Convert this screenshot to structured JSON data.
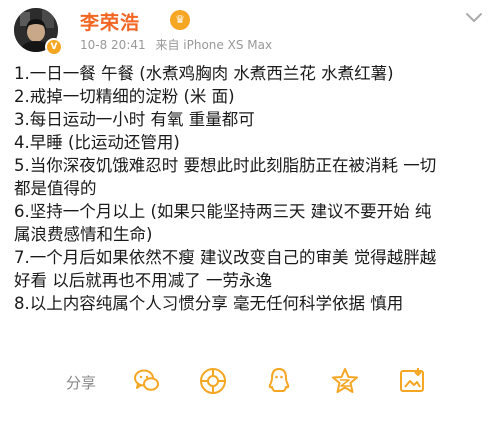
{
  "post": {
    "username": "李荣浩",
    "meta": {
      "time": "10-8 20:41",
      "source": "来自 iPhone XS Max"
    },
    "lines": [
      "1.一日一餐 午餐 (水煮鸡胸肉 水煮西兰花 水煮红薯)",
      "2.戒掉一切精细的淀粉 (米 面)",
      "3.每日运动一小时 有氧 重量都可",
      "4.早睡 (比运动还管用)",
      "5.当你深夜饥饿难忍时 要想此时此刻脂肪正在被消耗 一切",
      "都是值得的",
      "6.坚持一个月以上 (如果只能坚持两三天 建议不要开始 纯",
      "属浪费感情和生命)",
      "7.一个月后如果依然不瘦 建议改变自己的审美 觉得越胖越",
      "好看 以后就再也不用减了 一劳永逸",
      "8.以上内容纯属个人习惯分享 毫无任何科学依据 慎用"
    ]
  },
  "share": {
    "label": "分享",
    "icons": [
      "wechat-icon",
      "moments-icon",
      "qq-icon",
      "qzone-icon",
      "save-image-icon"
    ]
  },
  "colors": {
    "username": "#f26522",
    "share_icon": "#f5a623",
    "meta": "#999999"
  }
}
